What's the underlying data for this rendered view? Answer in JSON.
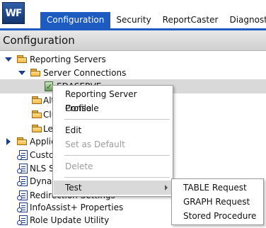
{
  "header": {
    "logo_text": "WF",
    "tabs": [
      {
        "label": "Configuration",
        "active": true
      },
      {
        "label": "Security",
        "active": false
      },
      {
        "label": "ReportCaster",
        "active": false
      },
      {
        "label": "Diagnostics",
        "active": false
      }
    ]
  },
  "panel": {
    "title": "Configuration"
  },
  "tree": {
    "items": [
      {
        "label": "Reporting Servers"
      },
      {
        "label": "Server Connections"
      },
      {
        "label": "EDASERVE"
      },
      {
        "label": "Alt"
      },
      {
        "label": "Clu"
      },
      {
        "label": "Le"
      },
      {
        "label": "Applic"
      },
      {
        "label": "Custo"
      },
      {
        "label": "NLS S"
      },
      {
        "label": "Dyna"
      },
      {
        "label": "Redirection Settings"
      },
      {
        "label": "InfoAssist+ Properties"
      },
      {
        "label": "Role Update Utility"
      }
    ]
  },
  "context_menu": {
    "items": [
      {
        "label": "Reporting Server Console",
        "enabled": true
      },
      {
        "label": "Profile",
        "enabled": true
      },
      {
        "label": "Edit",
        "enabled": true
      },
      {
        "label": "Set as Default",
        "enabled": false
      },
      {
        "label": "Delete",
        "enabled": false
      },
      {
        "label": "Test",
        "enabled": true,
        "has_submenu": true
      }
    ]
  },
  "submenu": {
    "items": [
      {
        "label": "TABLE Request"
      },
      {
        "label": "GRAPH Request"
      },
      {
        "label": "Stored Procedure"
      }
    ]
  },
  "colors": {
    "accent": "#1d5bc0",
    "panel_bg": "#d6d6d6",
    "selected_bg": "#d9d9d9"
  }
}
